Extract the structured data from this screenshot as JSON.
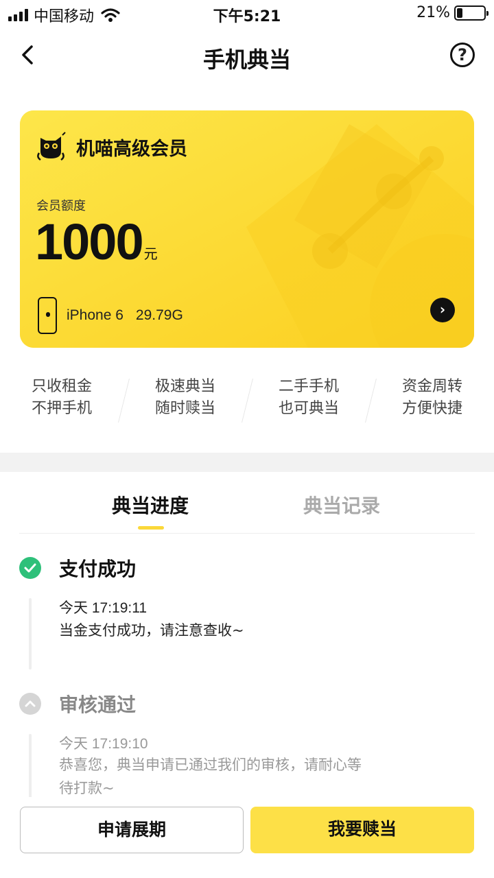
{
  "status_bar": {
    "carrier": "中国移动",
    "time": "下午5:21",
    "battery": "21%",
    "battery_level": 0.21
  },
  "nav": {
    "title": "手机典当",
    "back_icon": "chevron-left-icon",
    "help_icon": "question-circle-icon",
    "help_glyph": "?"
  },
  "card": {
    "title": "机喵高级会员",
    "quota_label": "会员额度",
    "quota_value": "1000",
    "quota_unit": "元",
    "phone_model": "iPhone 6",
    "phone_storage": "29.79G",
    "arrow_glyph": "›",
    "background_color": "#fbd83a"
  },
  "features": [
    {
      "line1": "只收租金",
      "line2": "不押手机"
    },
    {
      "line1": "极速典当",
      "line2": "随时赎当"
    },
    {
      "line1": "二手手机",
      "line2": "也可典当"
    },
    {
      "line1": "资金周转",
      "line2": "方便快捷"
    }
  ],
  "tabs": [
    {
      "label": "典当进度",
      "active": true
    },
    {
      "label": "典当记录",
      "active": false
    }
  ],
  "timeline": [
    {
      "status": "done",
      "title": "支付成功",
      "time": "今天 17:19:11",
      "desc": "当金支付成功，请注意查收~"
    },
    {
      "status": "pending",
      "title": "审核通过",
      "time": "今天 17:19:10",
      "desc": "恭喜您，典当申请已通过我们的审核，请耐心等待打款~"
    }
  ],
  "buttons": {
    "extend": "申请展期",
    "redeem": "我要赎当"
  },
  "colors": {
    "accent_yellow": "#fde047",
    "success_green": "#2ec07a",
    "pending_gray": "#d5d5d5"
  }
}
